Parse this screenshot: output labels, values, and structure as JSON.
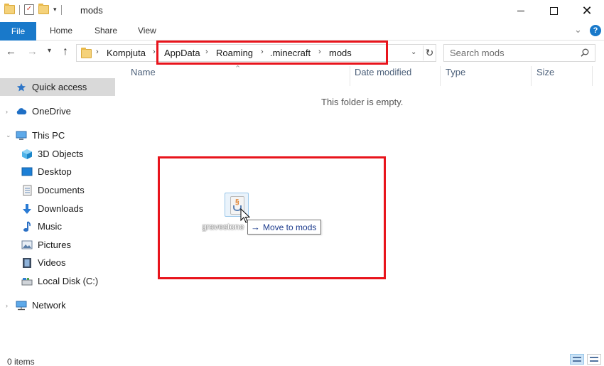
{
  "window": {
    "title": "mods"
  },
  "ribbon": {
    "tabs": [
      "File",
      "Home",
      "Share",
      "View"
    ]
  },
  "address": {
    "crumbs": [
      "Kompjuta",
      "AppData",
      "Roaming",
      ".minecraft",
      "mods"
    ]
  },
  "search": {
    "placeholder": "Search mods"
  },
  "nav": {
    "items": [
      {
        "label": "Quick access",
        "icon": "star-icon"
      },
      {
        "label": "OneDrive",
        "icon": "cloud-icon"
      },
      {
        "label": "This PC",
        "icon": "computer-icon"
      },
      {
        "label": "3D Objects",
        "icon": "cube-icon"
      },
      {
        "label": "Desktop",
        "icon": "desktop-icon"
      },
      {
        "label": "Documents",
        "icon": "document-icon"
      },
      {
        "label": "Downloads",
        "icon": "download-icon"
      },
      {
        "label": "Music",
        "icon": "music-icon"
      },
      {
        "label": "Pictures",
        "icon": "picture-icon"
      },
      {
        "label": "Videos",
        "icon": "video-icon"
      },
      {
        "label": "Local Disk (C:)",
        "icon": "disk-icon"
      },
      {
        "label": "Network",
        "icon": "network-icon"
      }
    ]
  },
  "columns": [
    "Name",
    "Date modified",
    "Type",
    "Size"
  ],
  "content": {
    "empty_message": "This folder is empty."
  },
  "drag": {
    "file_name": "gravestone",
    "tooltip": "Move to mods"
  },
  "status": {
    "items": "0 items"
  },
  "colors": {
    "accent": "#1979ca",
    "highlight": "#e8141c",
    "selection": "#d9d9d9"
  }
}
